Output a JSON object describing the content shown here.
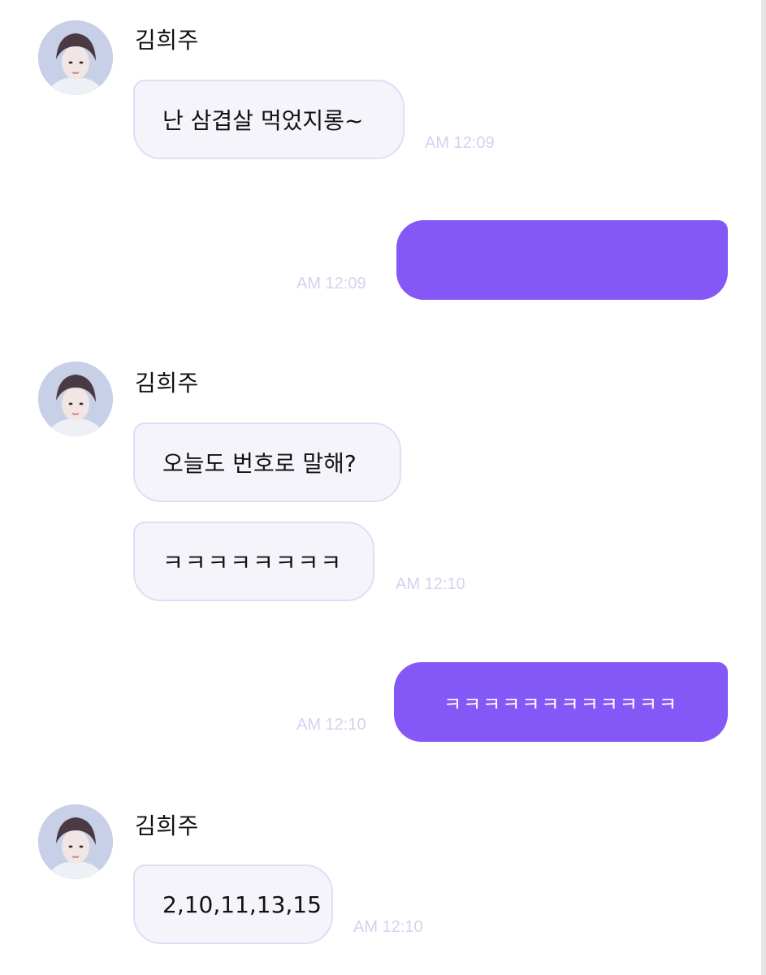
{
  "sender_name": "김희주",
  "messages": [
    {
      "side": "in",
      "text": "난 삼겹살 먹었지롱~",
      "time": "AM 12:09"
    },
    {
      "side": "out",
      "text": "",
      "time": "AM 12:09"
    },
    {
      "side": "in",
      "text": "오늘도 번호로 말해?",
      "time": ""
    },
    {
      "side": "in",
      "text": "ㅋㅋㅋㅋㅋㅋㅋㅋ",
      "time": "AM 12:10"
    },
    {
      "side": "out",
      "text": "ㅋㅋㅋㅋㅋㅋㅋㅋㅋㅋㅋㅋ",
      "time": "AM 12:10"
    },
    {
      "side": "in",
      "text": "2,10,11,13,15",
      "time": "AM 12:10"
    }
  ],
  "colors": {
    "outgoing_bubble": "#8457f7",
    "incoming_bubble": "#f5f4fb",
    "incoming_border": "#e3dcf5",
    "timestamp": "#d9cff0"
  }
}
